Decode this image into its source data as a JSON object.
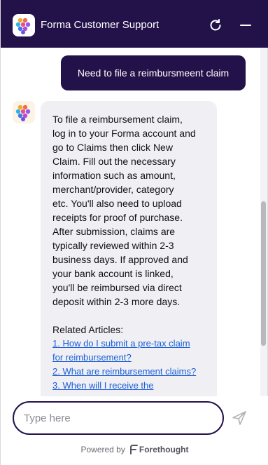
{
  "header": {
    "title": "Forma Customer Support",
    "background": "#23124a"
  },
  "conversation": {
    "user_message": "Need to file a reimbursmeent claim",
    "bot_message": "To file a reimbursement claim,\nlog in to your Forma account and\ngo to Claims then click New\nClaim. Fill out the necessary\ninformation such as amount,\nmerchant/provider, category\netc. You'll also need to upload\nreceipts for proof of purchase.\nAfter submission, claims are\ntypically reviewed within 2-3\nbusiness days. If approved and\nyour bank account is linked,\nyou'll be reimbursed via direct\ndeposit within 2-3 more days.",
    "related_heading": "Related Articles:",
    "related_articles": [
      "1. How do I submit a pre-tax claim\nfor reimbursement?",
      "2. What are reimbursement claims?",
      "3. When will I receive the"
    ]
  },
  "composer": {
    "placeholder": "Type here"
  },
  "footer": {
    "powered_by": "Powered by",
    "brand": "Forethought"
  },
  "icons": {
    "refresh": "refresh-icon",
    "minimize": "minimize-icon",
    "send": "send-icon",
    "logo": "forma-logo-icon",
    "brand": "forethought-icon"
  },
  "colors": {
    "accent": "#23124a",
    "link": "#1a5fd6",
    "bot_bubble": "#f0eff4"
  }
}
